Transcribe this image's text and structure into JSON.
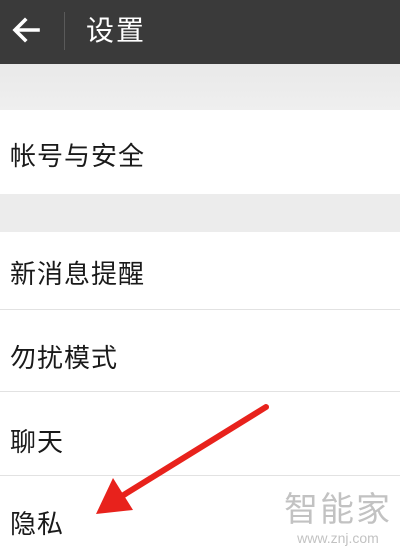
{
  "header": {
    "title": "设置",
    "back_icon": "arrow-left-icon"
  },
  "settings": {
    "account_security": "帐号与安全",
    "new_message_alert": "新消息提醒",
    "do_not_disturb": "勿扰模式",
    "chat": "聊天",
    "privacy": "隐私"
  },
  "annotation": {
    "arrow_color": "#e8221c"
  },
  "watermark": {
    "brand": "智能家",
    "url": "www.znj.com"
  },
  "colors": {
    "header_bg": "#3a3a3a",
    "section_gap": "#ececec"
  }
}
